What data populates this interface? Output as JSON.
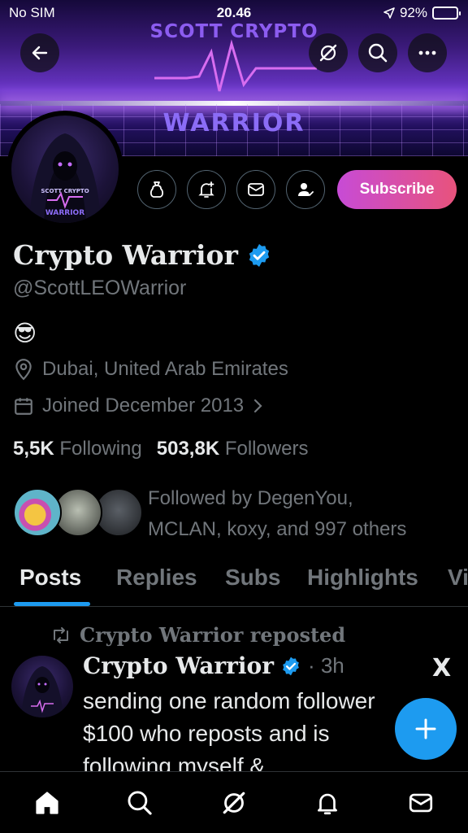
{
  "status_bar": {
    "carrier": "No SIM",
    "time": "20.46",
    "battery": "92%",
    "battery_level": 0.92
  },
  "banner": {
    "title_top": "SCOTT CRYPTO",
    "title_bottom": "WARRIOR"
  },
  "avatar_text": {
    "line1": "SCOTT CRYPTO",
    "line2": "WARRIOR"
  },
  "profile": {
    "display_name": "Crypto Warrior",
    "handle": "@ScottLEOWarrior",
    "bio": "😎",
    "location": "Dubai, United Arab Emirates",
    "joined": "Joined December 2013",
    "following_count": "5,5K",
    "following_label": "Following",
    "followers_count": "503,8K",
    "followers_label": "Followers",
    "followed_by_line1": "Followed by DegenYou,",
    "followed_by_line2": "MCLAN, koxy, and 997 others"
  },
  "actions": {
    "subscribe_label": "Subscribe"
  },
  "tabs": [
    "Posts",
    "Replies",
    "Subs",
    "Highlights",
    "Vi"
  ],
  "post": {
    "repost_label": "Crypto Warrior reposted",
    "author": "Crypto Warrior",
    "time": "· 3h",
    "text_line1": "sending one random follower",
    "text_line2": "$100 who reposts and is",
    "text_line3": "following myself &",
    "source_logo": "X"
  },
  "colors": {
    "accent": "#1d9bf0",
    "subscribe_start": "#c74bd6",
    "subscribe_end": "#e8537c",
    "verified": "#1d9bf0"
  }
}
